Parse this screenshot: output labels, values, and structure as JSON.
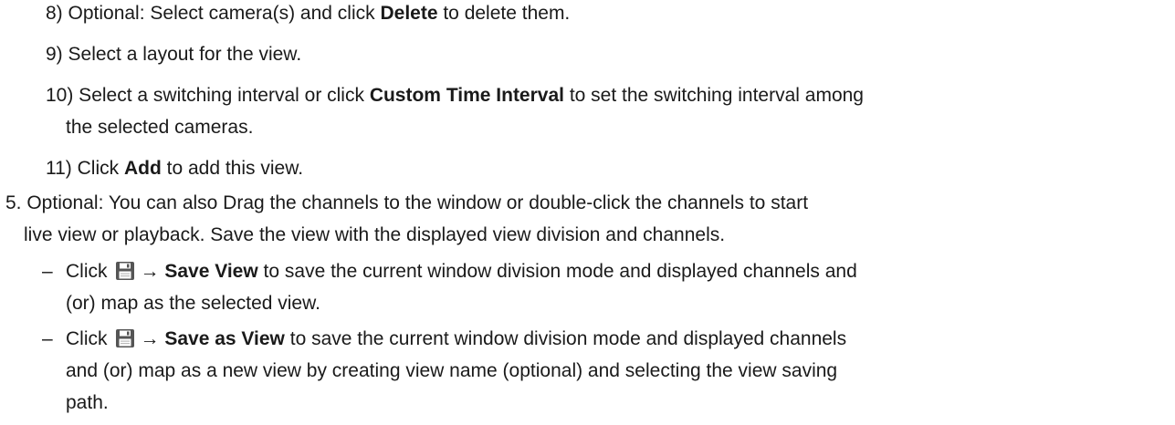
{
  "steps": {
    "s8": {
      "pre": "8) Optional: Select camera(s) and click ",
      "bold": "Delete",
      "post": " to delete them."
    },
    "s9": {
      "text": "9) Select a layout for the view."
    },
    "s10": {
      "pre": "10) Select a switching interval or click ",
      "bold": "Custom Time Interval",
      "post": " to set the switching interval among",
      "cont": "the selected cameras."
    },
    "s11": {
      "pre": "11) Click ",
      "bold": "Add",
      "post": " to add this view."
    }
  },
  "step5": {
    "line1": "5. Optional: You can also Drag the channels to the window or double-click the channels to start",
    "line2": "live view or playback. Save the view with the displayed view division and channels."
  },
  "bullets": [
    {
      "dash": "–",
      "click": "Click",
      "arrow": "→",
      "bold": "Save View",
      "post": " to save the current window division mode and displayed channels and",
      "cont": [
        "(or) map as the selected view."
      ]
    },
    {
      "dash": "–",
      "click": "Click",
      "arrow": "→",
      "bold": "Save as View",
      "post": " to save the current window division mode and displayed channels",
      "cont": [
        "and (or) map as a new view by creating view name (optional) and selecting the view saving",
        "path."
      ]
    }
  ],
  "icons": {
    "save": "save-icon"
  },
  "colors": {
    "text": "#1a1a1a",
    "icon_bg": "#555555",
    "icon_fg": "#ffffff"
  }
}
